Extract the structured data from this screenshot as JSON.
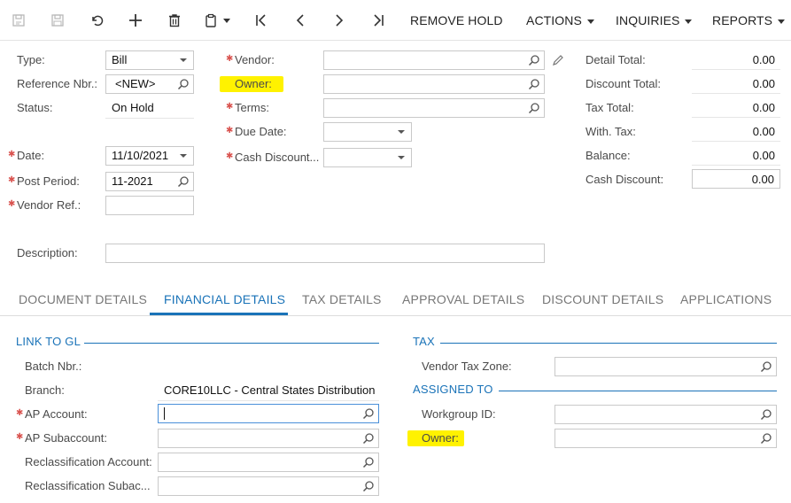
{
  "toolbar": {
    "remove_hold": "REMOVE HOLD",
    "actions": "ACTIONS",
    "inquiries": "INQUIRIES",
    "reports": "REPORTS"
  },
  "form": {
    "type_label": "Type:",
    "type_value": "Bill",
    "refnbr_label": "Reference Nbr.:",
    "refnbr_value": "<NEW>",
    "status_label": "Status:",
    "status_value": "On Hold",
    "date_label": "Date:",
    "date_value": "11/10/2021",
    "postperiod_label": "Post Period:",
    "postperiod_value": "11-2021",
    "vendorref_label": "Vendor Ref.:",
    "vendor_label": "Vendor:",
    "owner_label": "Owner:",
    "terms_label": "Terms:",
    "duedate_label": "Due Date:",
    "cashdiscount_label": "Cash Discount...",
    "description_label": "Description:"
  },
  "summary": {
    "detail_total_label": "Detail Total:",
    "detail_total": "0.00",
    "discount_total_label": "Discount Total:",
    "discount_total": "0.00",
    "tax_total_label": "Tax Total:",
    "tax_total": "0.00",
    "with_tax_label": "With. Tax:",
    "with_tax": "0.00",
    "balance_label": "Balance:",
    "balance": "0.00",
    "cash_discount_label": "Cash Discount:",
    "cash_discount": "0.00"
  },
  "tabs": [
    {
      "label": "DOCUMENT DETAILS"
    },
    {
      "label": "FINANCIAL DETAILS"
    },
    {
      "label": "TAX DETAILS"
    },
    {
      "label": "APPROVAL DETAILS"
    },
    {
      "label": "DISCOUNT DETAILS"
    },
    {
      "label": "APPLICATIONS"
    }
  ],
  "link_to_gl": {
    "title": "LINK TO GL",
    "batch_label": "Batch Nbr.:",
    "branch_label": "Branch:",
    "branch_value": "CORE10LLC - Central States Distribution",
    "ap_account_label": "AP Account:",
    "ap_subaccount_label": "AP Subaccount:",
    "reclass_account_label": "Reclassification Account:",
    "reclass_sub_label": "Reclassification Subac..."
  },
  "tax": {
    "title": "TAX",
    "vendor_tax_zone_label": "Vendor Tax Zone:"
  },
  "assigned_to": {
    "title": "ASSIGNED TO",
    "workgroup_label": "Workgroup ID:",
    "owner_label": "Owner:"
  },
  "colors": {
    "accent": "#1a73b8",
    "highlight": "#fff200",
    "required": "#d9534f"
  }
}
